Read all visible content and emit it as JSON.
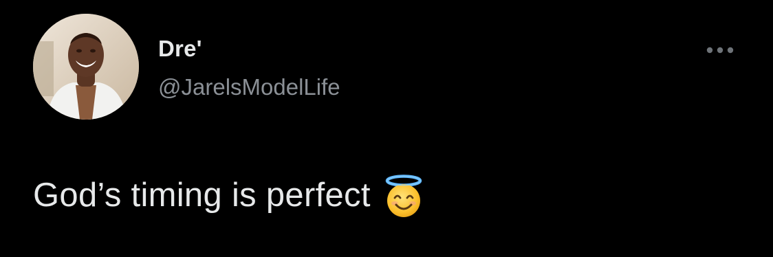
{
  "tweet": {
    "author": {
      "display_name": "Dre'",
      "handle": "@JarelsModelLife",
      "avatar_icon": "profile-photo"
    },
    "more_icon": "more-horizontal-icon",
    "text": "God’s timing is perfect",
    "emoji": "smiling-face-with-halo-emoji",
    "colors": {
      "background": "#000000",
      "primary_text": "#e7e9ea",
      "secondary_text": "#8b9096"
    }
  }
}
